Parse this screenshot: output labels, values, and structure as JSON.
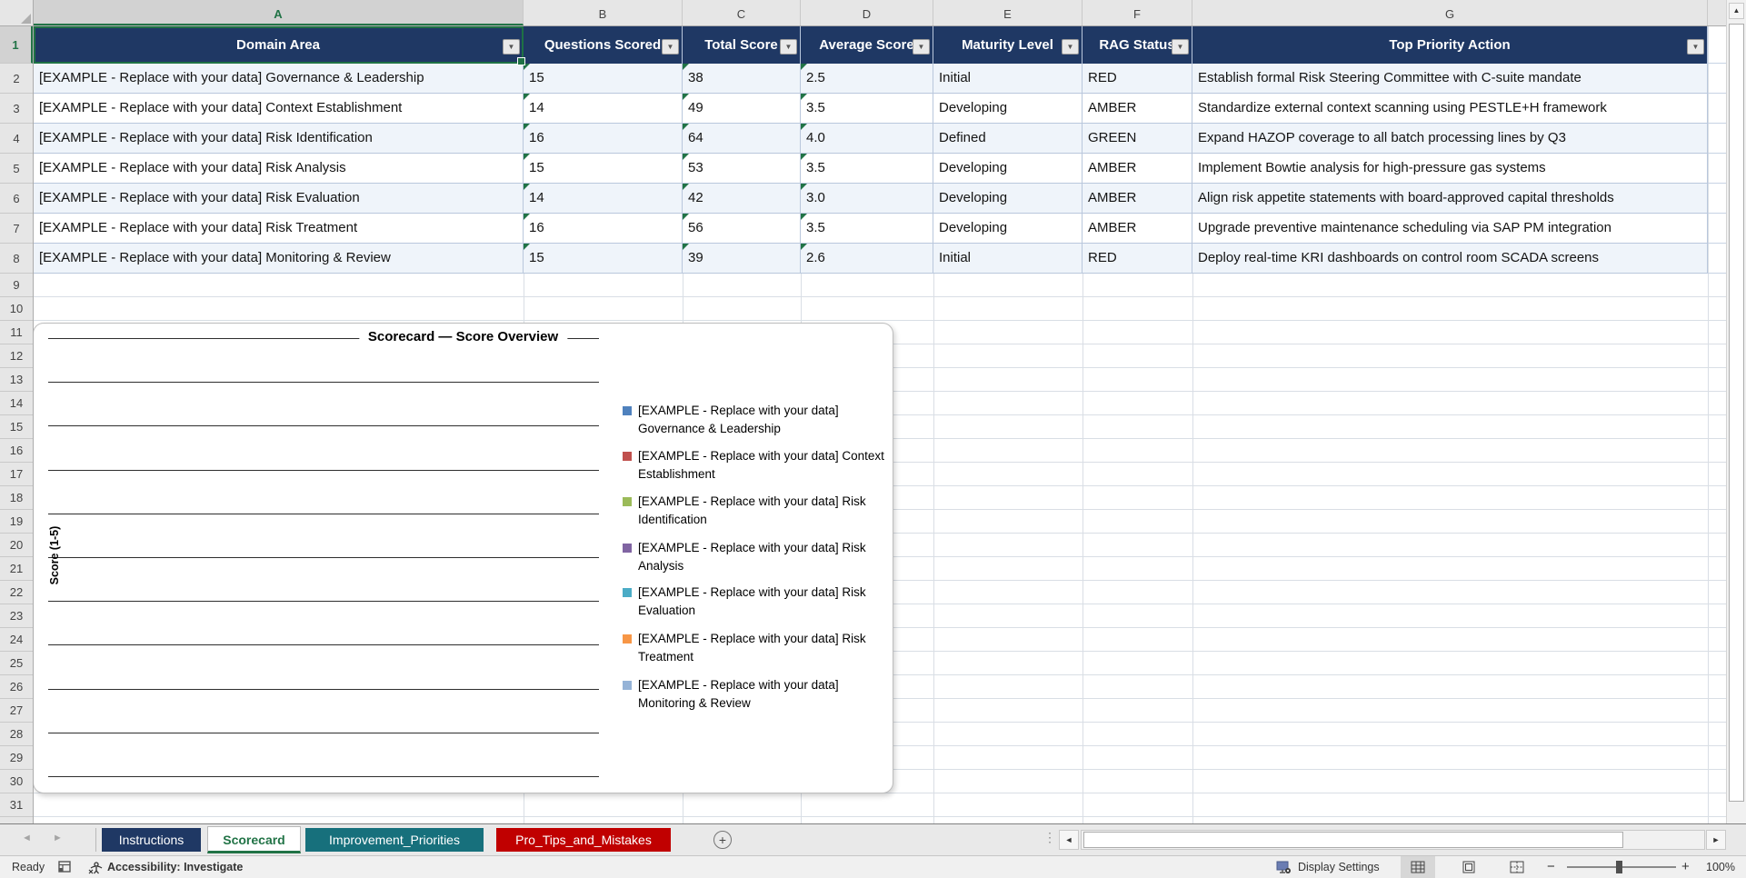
{
  "grid": {
    "columns": [
      "A",
      "B",
      "C",
      "D",
      "E",
      "F",
      "G"
    ],
    "visible_rows": 32,
    "selected_cell": "A1"
  },
  "table": {
    "headers": [
      "Domain Area",
      "Questions Scored",
      "Total Score",
      "Average Score",
      "Maturity Level",
      "RAG Status",
      "Top Priority Action"
    ],
    "rows": [
      [
        "[EXAMPLE - Replace with your data] Governance & Leadership",
        "15",
        "38",
        "2.5",
        "Initial",
        "RED",
        "Establish formal Risk Steering Committee with C-suite mandate"
      ],
      [
        "[EXAMPLE - Replace with your data] Context Establishment",
        "14",
        "49",
        "3.5",
        "Developing",
        "AMBER",
        "Standardize external context scanning using PESTLE+H framework"
      ],
      [
        "[EXAMPLE - Replace with your data] Risk Identification",
        "16",
        "64",
        "4.0",
        "Defined",
        "GREEN",
        "Expand HAZOP coverage to all batch processing lines by Q3"
      ],
      [
        "[EXAMPLE - Replace with your data] Risk Analysis",
        "15",
        "53",
        "3.5",
        "Developing",
        "AMBER",
        "Implement Bowtie analysis for high-pressure gas systems"
      ],
      [
        "[EXAMPLE - Replace with your data] Risk Evaluation",
        "14",
        "42",
        "3.0",
        "Developing",
        "AMBER",
        "Align risk appetite statements with board-approved capital thresholds"
      ],
      [
        "[EXAMPLE - Replace with your data] Risk Treatment",
        "16",
        "56",
        "3.5",
        "Developing",
        "AMBER",
        "Upgrade preventive maintenance scheduling via SAP PM integration"
      ],
      [
        "[EXAMPLE - Replace with your data] Monitoring & Review",
        "15",
        "39",
        "2.6",
        "Initial",
        "RED",
        "Deploy real-time KRI dashboards on control room SCADA screens"
      ]
    ]
  },
  "chart": {
    "title": "Scorecard — Score Overview",
    "y_axis_title": "Score (1-5)",
    "legend": [
      {
        "label": "[EXAMPLE - Replace with your data] Governance & Leadership",
        "color": "#4F81BD"
      },
      {
        "label": "[EXAMPLE - Replace with your data] Context Establishment",
        "color": "#C0504D"
      },
      {
        "label": "[EXAMPLE - Replace with your data] Risk Identification",
        "color": "#9BBB59"
      },
      {
        "label": "[EXAMPLE - Replace with your data] Risk Analysis",
        "color": "#8064A2"
      },
      {
        "label": "[EXAMPLE - Replace with your data] Risk Evaluation",
        "color": "#4BACC6"
      },
      {
        "label": "[EXAMPLE - Replace with your data] Risk Treatment",
        "color": "#F79646"
      },
      {
        "label": "[EXAMPLE - Replace with your data] Monitoring & Review",
        "color": "#95B3D7"
      }
    ]
  },
  "chart_data": {
    "type": "bar",
    "title": "Scorecard — Score Overview",
    "ylabel": "Score (1-5)",
    "ylim": [
      0,
      5
    ],
    "grid": true,
    "legend_position": "right",
    "series": [
      {
        "name": "[EXAMPLE - Replace with your data] Governance & Leadership",
        "values": []
      },
      {
        "name": "[EXAMPLE - Replace with your data] Context Establishment",
        "values": []
      },
      {
        "name": "[EXAMPLE - Replace with your data] Risk Identification",
        "values": []
      },
      {
        "name": "[EXAMPLE - Replace with your data] Risk Analysis",
        "values": []
      },
      {
        "name": "[EXAMPLE - Replace with your data] Risk Evaluation",
        "values": []
      },
      {
        "name": "[EXAMPLE - Replace with your data] Risk Treatment",
        "values": []
      },
      {
        "name": "[EXAMPLE - Replace with your data] Monitoring & Review",
        "values": []
      }
    ],
    "note": "Plot area shows horizontal gridlines only; no bars are rendered in the screenshot"
  },
  "sheet_tabs": [
    {
      "label": "Instructions",
      "bg": "#1F3864",
      "fg": "#FFFFFF",
      "active": false
    },
    {
      "label": "Scorecard",
      "bg": "#FFFFFF",
      "fg": "#217346",
      "active": true
    },
    {
      "label": "Improvement_Priorities",
      "bg": "#17707C",
      "fg": "#FFFFFF",
      "active": false
    },
    {
      "label": "Pro_Tips_and_Mistakes",
      "bg": "#C00000",
      "fg": "#FFFFFF",
      "active": false
    }
  ],
  "status_bar": {
    "ready": "Ready",
    "accessibility": "Accessibility: Investigate",
    "display_settings": "Display Settings",
    "zoom_level": "100%"
  },
  "icons": {
    "filter": "▼",
    "add_sheet": "+",
    "nav_left": "◄",
    "nav_right": "►",
    "scroll_left": "◄",
    "scroll_right": "►",
    "scroll_up": "▲",
    "splitter": "⋮",
    "zoom_out": "−",
    "zoom_in": "+"
  },
  "colors": {
    "table_header_fill": "#1F3864",
    "selection_green": "#1E7145",
    "active_tab_green": "#217346",
    "banded_row_fill": "#EFF4FA",
    "error_triangle": "#217346"
  }
}
